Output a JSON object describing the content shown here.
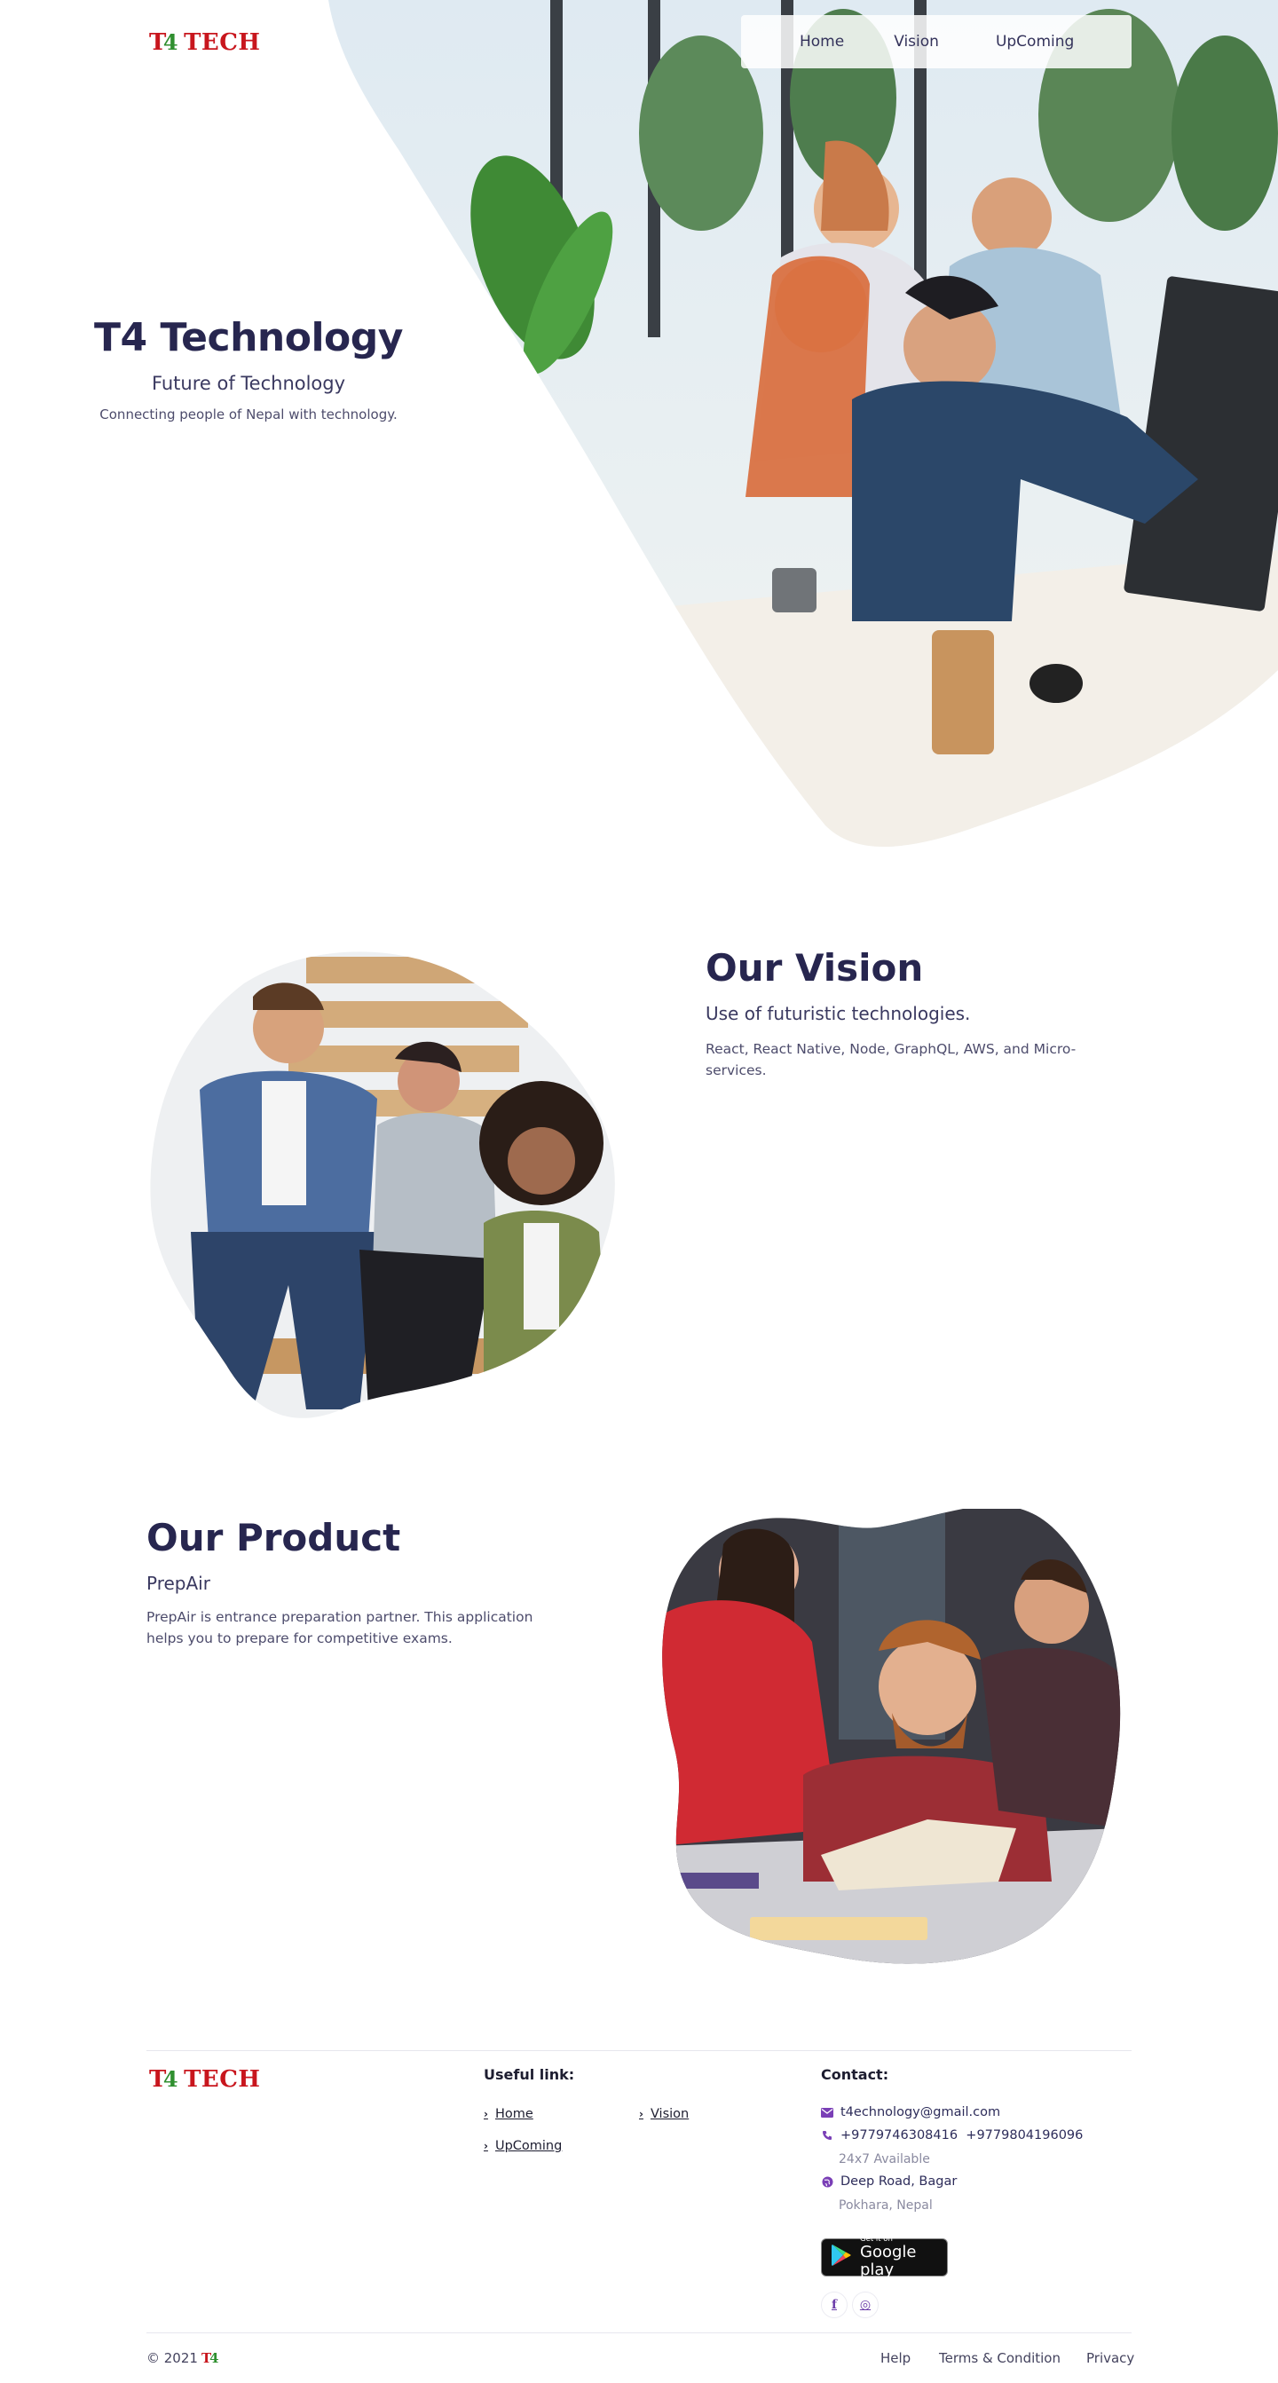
{
  "header": {
    "logo_text": "TECH",
    "logo_t": "T",
    "logo_4": "4",
    "nav": [
      {
        "label": "Home"
      },
      {
        "label": "Vision"
      },
      {
        "label": "UpComing"
      }
    ]
  },
  "hero": {
    "title": "T4 Technology",
    "subtitle": "Future of Technology",
    "description": "Connecting people of Nepal with technology."
  },
  "vision": {
    "title": "Our Vision",
    "subtitle": "Use of futuristic technologies.",
    "description": "React, React Native, Node, GraphQL, AWS, and Micro-services."
  },
  "product": {
    "title": "Our Product",
    "subtitle": "PrepAir",
    "description": "PrepAir is entrance preparation partner. This application helps you to prepare for competitive exams."
  },
  "footer": {
    "useful_heading": "Useful link:",
    "links": [
      {
        "label": "Home"
      },
      {
        "label": "Vision"
      },
      {
        "label": "UpComing"
      }
    ],
    "contact_heading": "Contact:",
    "email": "t4echnology@gmail.com",
    "phones": "+9779746308416  +9779804196096",
    "availability": "24x7 Available",
    "address_line1": "Deep Road, Bagar",
    "address_line2": "Pokhara, Nepal",
    "gplay_small": "Get it on",
    "gplay_big": "Google play",
    "social": [
      {
        "icon": "facebook-icon",
        "glyph": "f"
      },
      {
        "icon": "instagram-icon",
        "glyph": "◎"
      }
    ],
    "copyright": "© 2021",
    "bottom_links": [
      {
        "label": "Help"
      },
      {
        "label": "Terms & Condition"
      },
      {
        "label": "Privacy"
      }
    ]
  },
  "colors": {
    "brand_red": "#c8161d",
    "brand_green": "#2f8f2f",
    "heading_navy": "#27264f",
    "icon_purple": "#6a3aa8"
  }
}
